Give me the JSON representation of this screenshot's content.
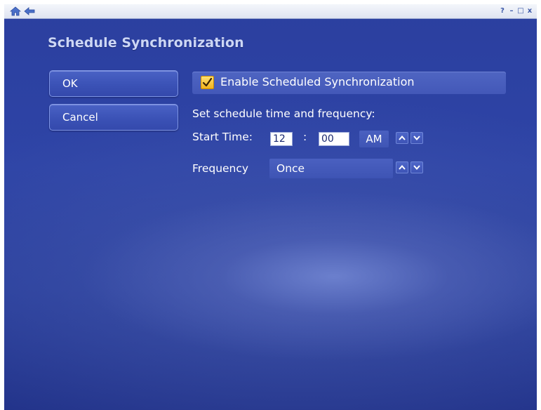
{
  "titlebar": {
    "help_symbol": "?",
    "minimize_symbol": "–",
    "maximize_symbol": "□",
    "close_symbol": "x"
  },
  "page": {
    "title": "Schedule Synchronization"
  },
  "buttons": {
    "ok_label": "OK",
    "cancel_label": "Cancel"
  },
  "schedule": {
    "enable_label": "Enable Scheduled Synchronization",
    "enabled": true,
    "instructions": "Set schedule time and frequency:",
    "start_time_label": "Start Time:",
    "hour": "12",
    "separator": ":",
    "minute": "00",
    "am_pm": "AM",
    "frequency_label": "Frequency",
    "frequency_value": "Once"
  },
  "colors": {
    "background": "#2e44a6",
    "title_text": "#cdd7f5",
    "checkbox": "#f2b21d"
  },
  "icons": {
    "home": "home-icon",
    "back": "back-arrow-icon",
    "up": "chevron-up-icon",
    "down": "chevron-down-icon"
  }
}
